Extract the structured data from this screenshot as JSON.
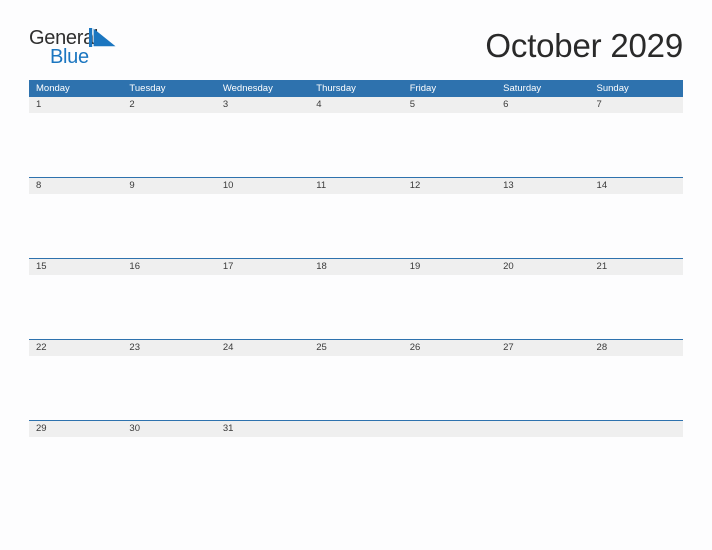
{
  "brand": {
    "name_top": "General",
    "name_bottom": "Blue",
    "flag_icon": "blue-flag-icon",
    "color_text": "#2f2f2f",
    "color_blue": "#1b76c0"
  },
  "header": {
    "title": "October 2029"
  },
  "theme": {
    "header_blue": "#2e72ae",
    "row_band_gray": "#efefef",
    "page_background": "#fdfdfe",
    "day_number_color": "#3a3a3a",
    "weekday_text_color": "#ffffff"
  },
  "calendar": {
    "month": "October",
    "year": "2029",
    "weekday_headers": [
      "Monday",
      "Tuesday",
      "Wednesday",
      "Thursday",
      "Friday",
      "Saturday",
      "Sunday"
    ],
    "weeks": [
      {
        "days": [
          {
            "num": "1"
          },
          {
            "num": "2"
          },
          {
            "num": "3"
          },
          {
            "num": "4"
          },
          {
            "num": "5"
          },
          {
            "num": "6"
          },
          {
            "num": "7"
          }
        ]
      },
      {
        "days": [
          {
            "num": "8"
          },
          {
            "num": "9"
          },
          {
            "num": "10"
          },
          {
            "num": "11"
          },
          {
            "num": "12"
          },
          {
            "num": "13"
          },
          {
            "num": "14"
          }
        ]
      },
      {
        "days": [
          {
            "num": "15"
          },
          {
            "num": "16"
          },
          {
            "num": "17"
          },
          {
            "num": "18"
          },
          {
            "num": "19"
          },
          {
            "num": "20"
          },
          {
            "num": "21"
          }
        ]
      },
      {
        "days": [
          {
            "num": "22"
          },
          {
            "num": "23"
          },
          {
            "num": "24"
          },
          {
            "num": "25"
          },
          {
            "num": "26"
          },
          {
            "num": "27"
          },
          {
            "num": "28"
          }
        ]
      },
      {
        "days": [
          {
            "num": "29"
          },
          {
            "num": "30"
          },
          {
            "num": "31"
          },
          {
            "num": ""
          },
          {
            "num": ""
          },
          {
            "num": ""
          },
          {
            "num": ""
          }
        ]
      }
    ]
  }
}
